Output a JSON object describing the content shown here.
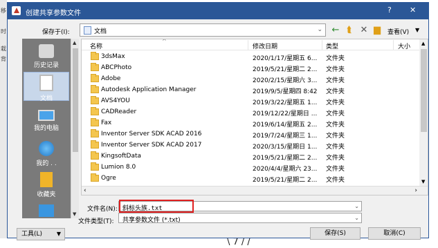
{
  "background": {
    "left_glyphs": [
      "移",
      "时",
      "栽",
      "背"
    ],
    "bottom_glyph": "\\ 7 / /"
  },
  "window": {
    "title": "创建共享参数文件",
    "help": "?",
    "close": "✕"
  },
  "toolbar": {
    "save_in_label": "保存于(I):",
    "folder_value": "文档",
    "view_label": "查看(V)",
    "back_icon": "←",
    "up_icon": "⮬",
    "delete_icon": "✕",
    "newfolder_icon": "▆",
    "dropdown_icon": "⌄"
  },
  "places": [
    {
      "label": "历史记录",
      "icon": "recent-icon"
    },
    {
      "label": "文档",
      "icon": "documents-icon"
    },
    {
      "label": "我的电脑",
      "icon": "computer-icon"
    },
    {
      "label": "我的 . .",
      "icon": "network-icon"
    },
    {
      "label": "收藏夹",
      "icon": "favorites-icon"
    },
    {
      "label": "",
      "icon": "desktop-icon"
    }
  ],
  "file_list": {
    "columns": [
      "名称",
      "修改日期",
      "类型",
      "大小"
    ],
    "rows": [
      {
        "name": "3dsMax",
        "date": "2020/1/17/星期五 6...",
        "type": "文件夹"
      },
      {
        "name": "ABCPhoto",
        "date": "2019/5/21/星期二 2...",
        "type": "文件夹"
      },
      {
        "name": "Adobe",
        "date": "2020/2/15/星期六 3...",
        "type": "文件夹"
      },
      {
        "name": "Autodesk Application Manager",
        "date": "2019/9/5/星期四 8:42",
        "type": "文件夹"
      },
      {
        "name": "AVS4YOU",
        "date": "2019/3/22/星期五 1...",
        "type": "文件夹"
      },
      {
        "name": "CADReader",
        "date": "2019/12/22/星期日 ...",
        "type": "文件夹"
      },
      {
        "name": "Fax",
        "date": "2019/6/14/星期五 2...",
        "type": "文件夹"
      },
      {
        "name": "Inventor Server SDK ACAD 2016",
        "date": "2019/7/24/星期三 1...",
        "type": "文件夹"
      },
      {
        "name": "Inventor Server SDK ACAD 2017",
        "date": "2020/3/15/星期日 1...",
        "type": "文件夹"
      },
      {
        "name": "KingsoftData",
        "date": "2019/5/21/星期二 2...",
        "type": "文件夹"
      },
      {
        "name": "Lumion 8.0",
        "date": "2020/4/4/星期六 23...",
        "type": "文件夹"
      },
      {
        "name": "Ogre",
        "date": "2019/5/21/星期二 2...",
        "type": "文件夹"
      }
    ]
  },
  "file_name": {
    "label": "文件名(N):",
    "value": "斜标头族.txt"
  },
  "file_type": {
    "label": "文件类型(T):",
    "value": "共享参数文件 (*.txt)"
  },
  "buttons": {
    "tools": "工具(L)",
    "save": "保存(S)",
    "cancel": "取消(C)"
  }
}
